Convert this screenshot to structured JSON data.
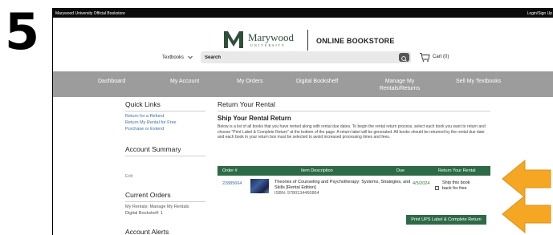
{
  "step_number": "5",
  "topbar": {
    "site_label": "Marywood University Official Bookstore",
    "login_label": "Login/Sign Up"
  },
  "logo": {
    "name": "Marywood",
    "sub": "UNIVERSITY",
    "store": "ONLINE BOOKSTORE"
  },
  "header": {
    "textbooks_label": "Textbooks",
    "search_placeholder": "Search",
    "cart_label": "Cart (0)"
  },
  "nav": {
    "items": [
      "Dashboard",
      "My Account",
      "My Orders",
      "Digital Bookshelf",
      "Manage My Rentals/Returns",
      "Sell My Textbooks"
    ]
  },
  "sidebar": {
    "quick_links_heading": "Quick Links",
    "links": [
      "Return for a Refund",
      "Return My Rental for Free",
      "Purchase or Extend"
    ],
    "account_summary_heading": "Account Summary",
    "edit_label": "Edit",
    "current_orders_heading": "Current Orders",
    "orders_text": [
      "My Rentals: Manage My Rentals",
      "Digital Bookshelf: 1"
    ],
    "account_alerts_heading": "Account Alerts"
  },
  "main": {
    "page_title": "Return Your Rental",
    "sub_title": "Ship Your Rental Return",
    "intro": "Below is a list of all books that you have rented along with rental due dates. To begin the rental return process, select each book you want to return and choose \"Print Label & Complete Return\" at the bottom of the page. A return label will be generated. All books should be returned by the rental due date and each book in your return box must be selected to avoid increased processing times and fees."
  },
  "table": {
    "headers": [
      "Order #",
      "Item Description",
      "Due",
      "Return Your Rental"
    ],
    "rows": [
      {
        "order": "22885664",
        "title": "Theories of Counseling and Psychotherapy: Systems, Strategies, and Skills [Rental Edition]",
        "isbn": "ISBN: 9780134460864",
        "due": "4/5/2024",
        "ship_label": "Ship this book back for free",
        "checked": false
      }
    ]
  },
  "print_button_label": "Print UPS Label & Complete Return",
  "colors": {
    "brand_green": "#2d6a46",
    "nav_gray": "#9c9c9c",
    "arrow_orange": "#f5a623",
    "link_blue": "#3a6ea8"
  },
  "icons": [
    "chevron-down-icon",
    "search-icon",
    "cart-icon",
    "arrow-left-icon"
  ]
}
